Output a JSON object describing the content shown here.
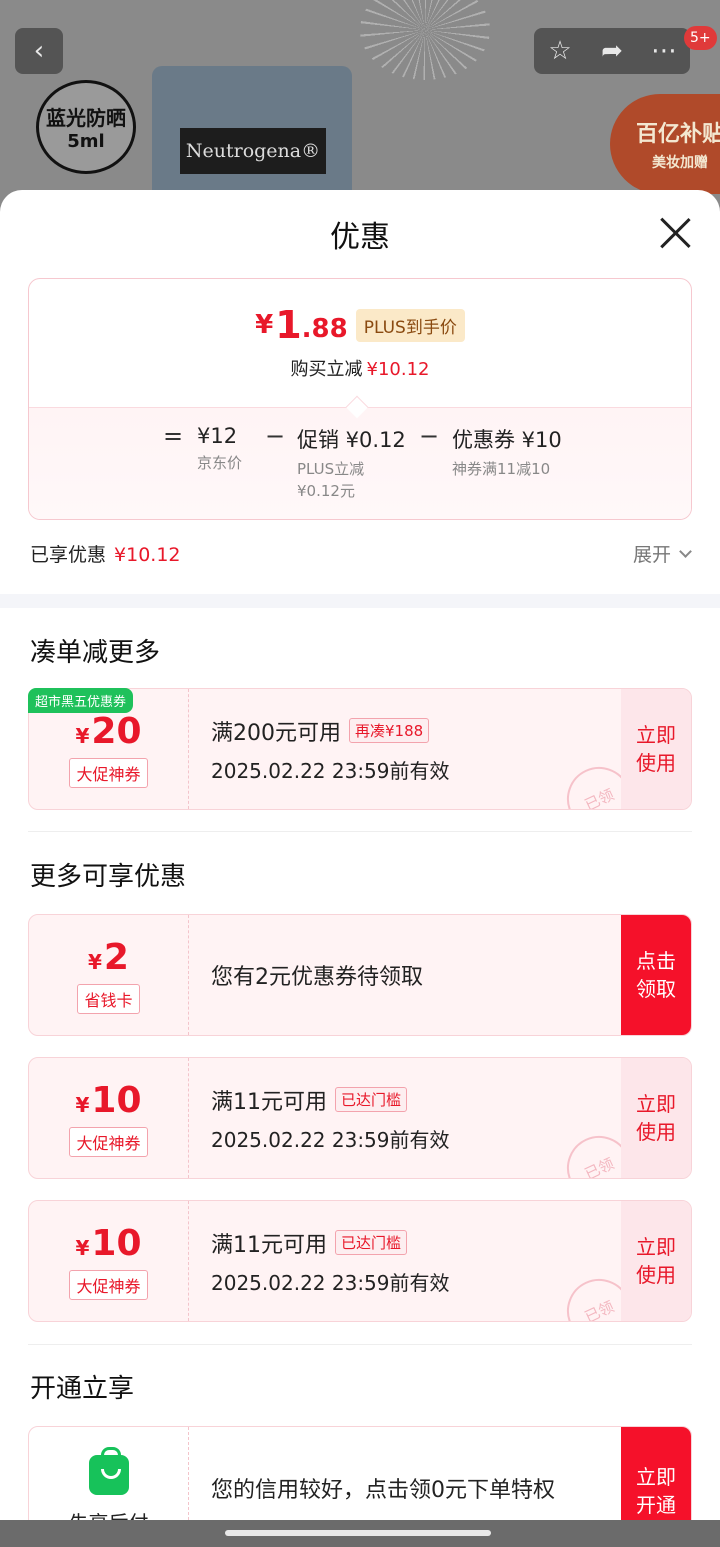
{
  "background_page": {
    "product_badge_line1": "蓝光防晒",
    "product_badge_line2": "5ml",
    "product_brand": "Neutrogena®",
    "notification_count": "5+",
    "subsidy_line1": "百亿补贴",
    "subsidy_line2": "美妆加赠"
  },
  "sheet": {
    "title": "优惠"
  },
  "price_summary": {
    "yen": "¥",
    "price_int": "1",
    "price_dec": ".88",
    "plus_tag": "PLUS到手价",
    "reduce_label": "购买立减",
    "reduce_amount": "¥10.12",
    "equals": "=",
    "minus": "−",
    "base_price": "¥12",
    "base_price_label": "京东价",
    "promo_main": "促销 ¥0.12",
    "promo_sub1": "PLUS立减",
    "promo_sub2": "¥0.12元",
    "coupon_main": "优惠券 ¥10",
    "coupon_sub": "神券满11减10"
  },
  "enjoyed": {
    "label": "已享优惠",
    "amount": "¥10.12",
    "expand": "展开"
  },
  "section_more": {
    "title": "凑单减更多",
    "badge": "超市黑五优惠券",
    "coupon": {
      "yen": "¥",
      "amount": "20",
      "type": "大促神券",
      "condition": "满200元可用",
      "tag": "再凑¥188",
      "validity": "2025.02.22 23:59前有效",
      "action": "立即使用",
      "stamp": "已领"
    }
  },
  "section_extra": {
    "title": "更多可享优惠",
    "coupons": [
      {
        "yen": "¥",
        "amount": "2",
        "type": "省钱卡",
        "text": "您有2元优惠券待领取",
        "action": "点击领取"
      },
      {
        "yen": "¥",
        "amount": "10",
        "type": "大促神券",
        "condition": "满11元可用",
        "tag": "已达门槛",
        "validity": "2025.02.22 23:59前有效",
        "action": "立即使用",
        "stamp": "已领"
      },
      {
        "yen": "¥",
        "amount": "10",
        "type": "大促神券",
        "condition": "满11元可用",
        "tag": "已达门槛",
        "validity": "2025.02.22 23:59前有效",
        "action": "立即使用",
        "stamp": "已领"
      }
    ]
  },
  "section_open": {
    "title": "开通立享",
    "card": {
      "label": "先享后付",
      "text": "您的信用较好，点击领0元下单特权",
      "action": "立即开通"
    }
  },
  "colors": {
    "accent_red": "#e8182a",
    "solid_button": "#f5112a",
    "green_badge": "#1fc15b",
    "plus_tag_bg": "#fbe9c8"
  }
}
